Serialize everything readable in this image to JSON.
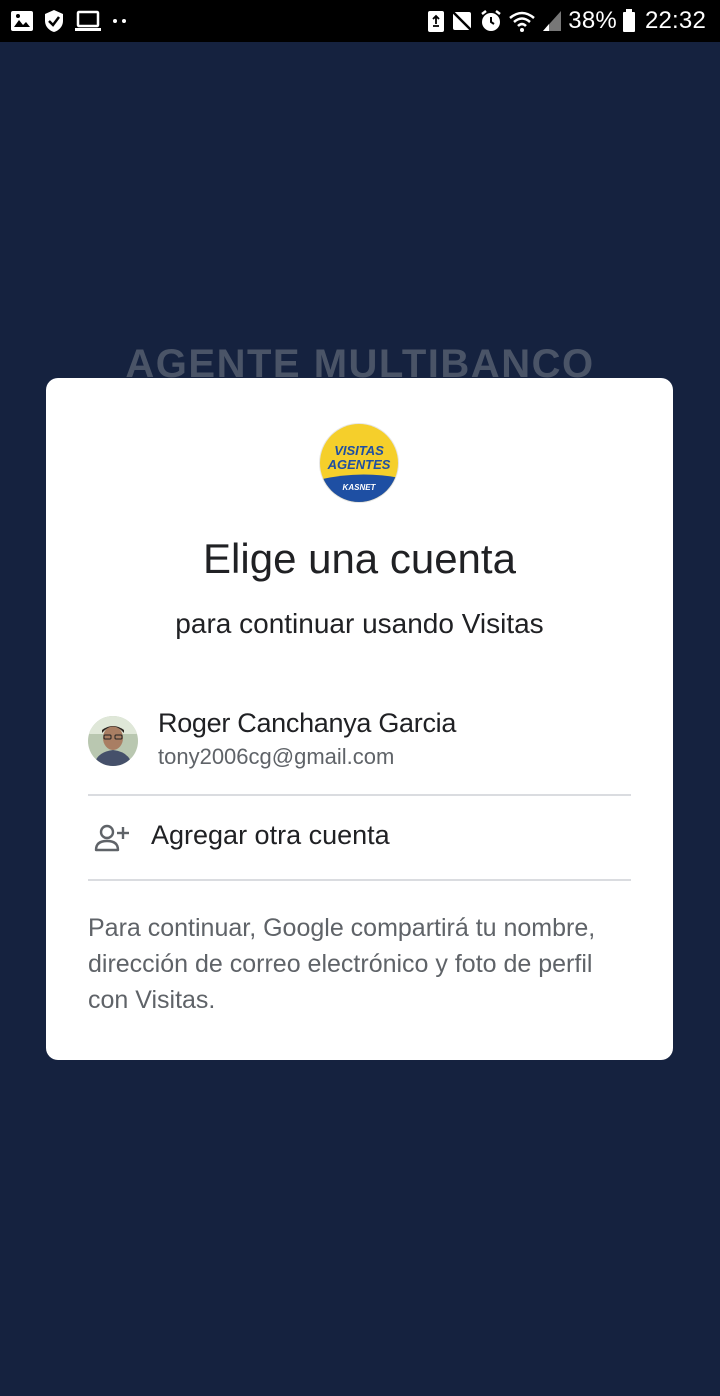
{
  "status_bar": {
    "left_icons": [
      "image-icon",
      "shield-check-icon",
      "laptop-icon",
      "more-dots-icon"
    ],
    "right_icons": [
      "recycle-icon",
      "mute-icon",
      "alarm-icon",
      "wifi-icon",
      "signal-icon",
      "battery-icon"
    ],
    "battery_percent": "38%",
    "time": "22:32"
  },
  "background_app": {
    "heading": "AGENTE MULTIBANCO"
  },
  "dialog": {
    "logo": {
      "line1": "VISITAS",
      "line2": "AGENTES",
      "brand": "KASNET",
      "colors": {
        "yellow": "#f5cf2b",
        "blue": "#1e4fa3"
      }
    },
    "title": "Elige una cuenta",
    "subtitle": "para continuar usando Visitas",
    "account": {
      "name": "Roger Canchanya Garcia",
      "email": "tony2006cg@gmail.com"
    },
    "add_account_label": "Agregar otra cuenta",
    "disclaimer": "Para continuar, Google compartirá tu nombre, dirección de correo electrónico y foto de perfil con Visitas."
  }
}
